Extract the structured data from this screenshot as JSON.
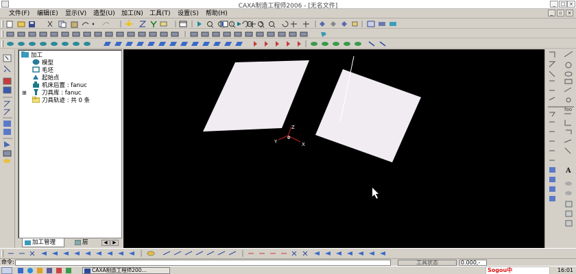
{
  "window": {
    "title": "CAXA制造工程师2006 - [无名文件]"
  },
  "menu": {
    "items": [
      "文件(F)",
      "编辑(E)",
      "显示(V)",
      "造型(U)",
      "加工(N)",
      "工具(T)",
      "设置(S)",
      "帮助(H)"
    ]
  },
  "tree": {
    "root": "加工",
    "nodes": [
      "模型",
      "毛坯",
      "起始点",
      "机床后置 : fanuc",
      "刀具库 : fanuc",
      "刀具轨迹 : 共 0 条"
    ]
  },
  "tabs": {
    "manage": "加工管理",
    "layer": "层"
  },
  "axes": {
    "z": "Z",
    "y": "Y",
    "x": "X",
    "origin": "0"
  },
  "command": {
    "label": "命令:",
    "status": "工具状态",
    "coord": "0.000,-"
  },
  "taskbar": {
    "task": "CAXA制造工程师200...",
    "ime": "Sogou中",
    "clock": "16:01"
  },
  "colors": {
    "viewport": "#000000",
    "surface": "#f0ecf2",
    "desktop": "#d4d0c8"
  },
  "icons": {
    "open": "open-file-icon",
    "save": "save-icon",
    "zoom": "zoom-icon",
    "rotate": "rotate-icon",
    "machine": "machine-tool-icon",
    "tool": "cutting-tool-icon"
  }
}
